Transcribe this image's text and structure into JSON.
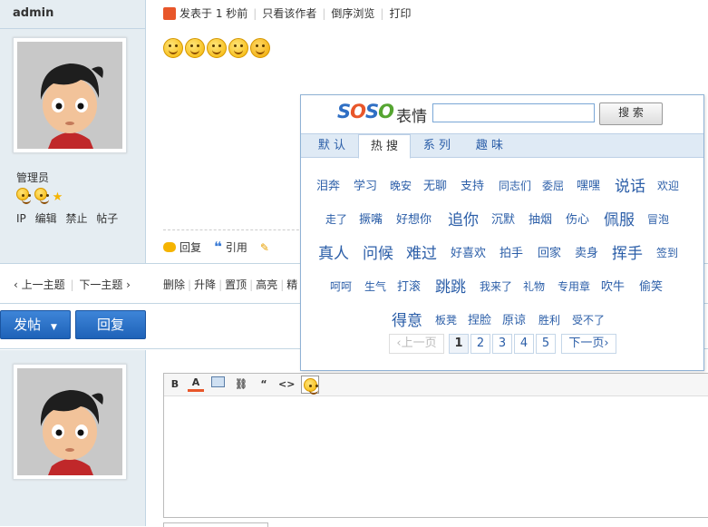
{
  "author": {
    "name": "admin",
    "group": "管理员"
  },
  "user_links": [
    "IP",
    "编辑",
    "禁止",
    "帖子"
  ],
  "post_header": {
    "posted": "发表于 1 秒前",
    "only_author": "只看该作者",
    "reverse": "倒序浏览",
    "print": "打印"
  },
  "post_actions": {
    "reply": "回复",
    "quote": "引用"
  },
  "thread_nav": {
    "prev": "上一主题",
    "next": "下一主题"
  },
  "mod_links": [
    "删除",
    "升降",
    "置顶",
    "高亮",
    "精"
  ],
  "buttons": {
    "new_post": "发帖",
    "reply": "回复"
  },
  "editor_toolbar": [
    "B",
    "A"
  ],
  "soso": {
    "logo": "SOSO",
    "title": "表情",
    "search_value": "",
    "search_button": "搜 索",
    "tabs": [
      "默 认",
      "热 搜",
      "系 列",
      "趣 味"
    ],
    "active_tab": "热 搜",
    "keywords": [
      [
        "泪奔",
        "学习",
        "晚安",
        "无聊",
        "支持",
        "同志们",
        "委屈",
        "嘿嘿",
        "说话",
        "欢迎"
      ],
      [
        "走了",
        "撅嘴",
        "好想你",
        "追你",
        "沉默",
        "抽烟",
        "伤心",
        "佩服",
        "冒泡"
      ],
      [
        "真人",
        "问候",
        "难过",
        "好喜欢",
        "拍手",
        "回家",
        "卖身",
        "挥手",
        "签到"
      ],
      [
        "呵呵",
        "生气",
        "打滚",
        "跳跳",
        "我来了",
        "礼物",
        "专用章",
        "吹牛",
        "偷笑"
      ],
      [
        "得意",
        "板凳",
        "捏脸",
        "原谅",
        "胜利",
        "受不了"
      ]
    ],
    "pagination": {
      "prev": "上一页",
      "pages": [
        "1",
        "2",
        "3",
        "4",
        "5"
      ],
      "current": "1",
      "next": "下一页"
    }
  },
  "colors": {
    "sidebar": "#e5edf2",
    "accent": "#2b5ea8",
    "button": "#2a6fc9"
  }
}
